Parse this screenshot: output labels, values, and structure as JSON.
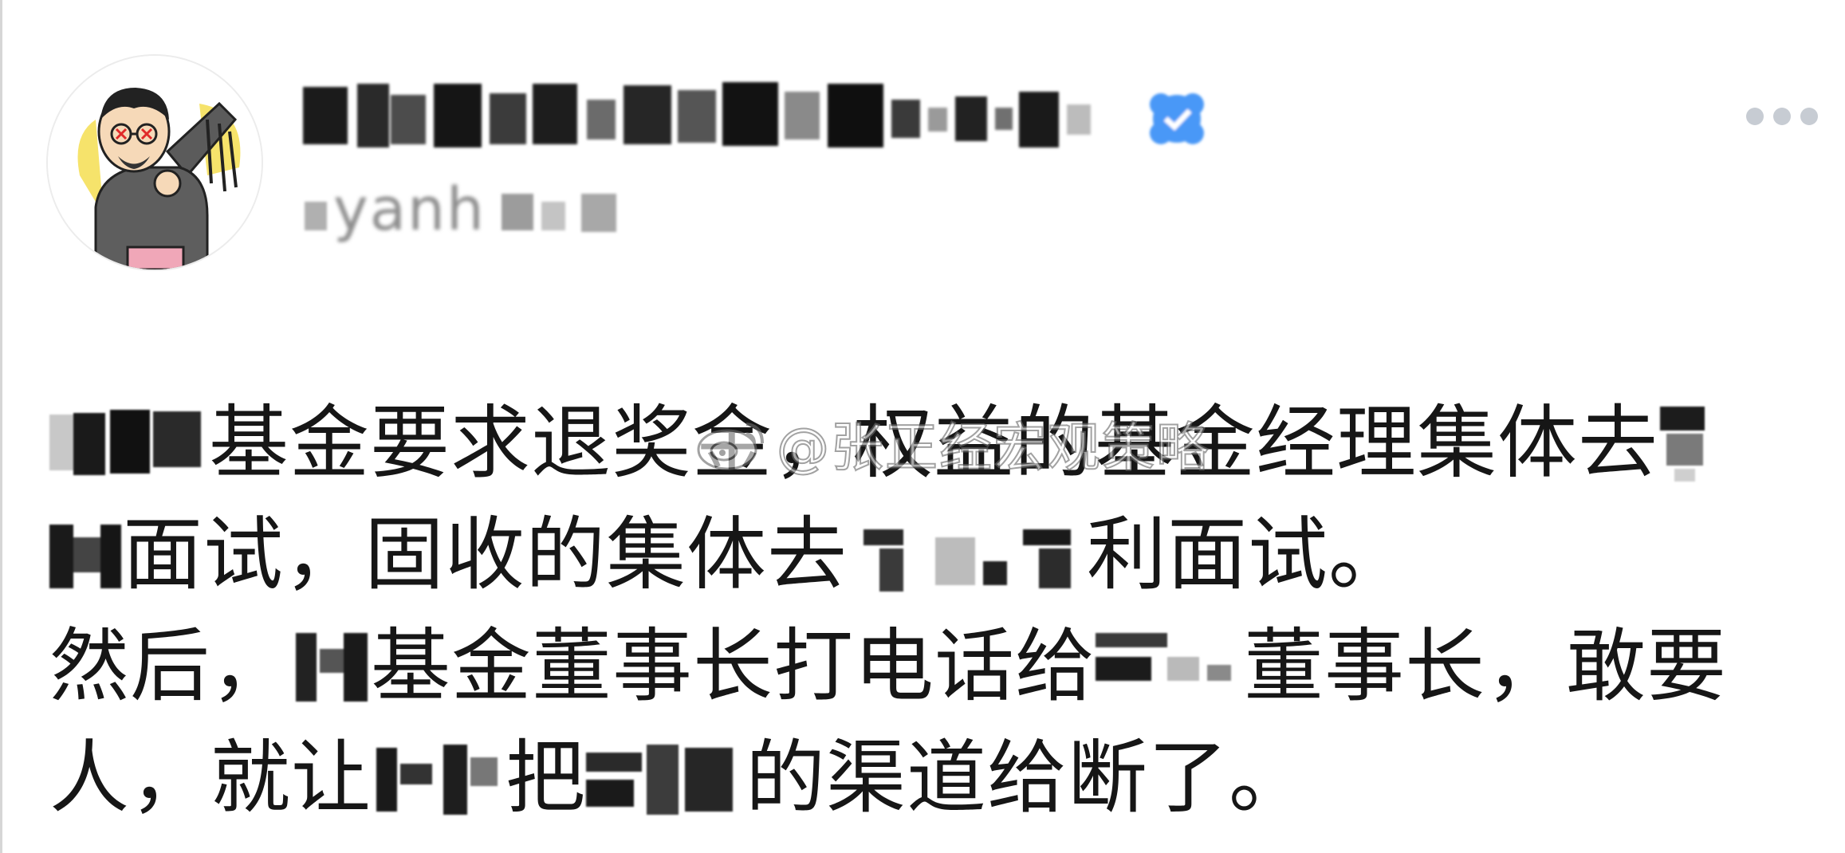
{
  "post": {
    "handle_visible": "yanh",
    "more_icon": "more-horizontal-icon",
    "verified_icon": "verified-badge-icon",
    "avatar_icon": "cartoon-avatar",
    "lines": [
      [
        "基金要求退奖金，权益的基金经理集体去",
        ""
      ],
      [
        "面试，固收的集体去",
        "利面试。"
      ],
      [
        "然后，",
        "基金董事长打电话给",
        "董事长，敢要"
      ],
      [
        "人，就让",
        "把",
        "的渠道给断了。"
      ]
    ]
  },
  "watermark": {
    "text": "@张正经宏观策略",
    "icon": "weibo-logo-icon"
  },
  "colors": {
    "verified": "#4a98f7",
    "text": "#161616",
    "dots": "#c7ccd3"
  }
}
